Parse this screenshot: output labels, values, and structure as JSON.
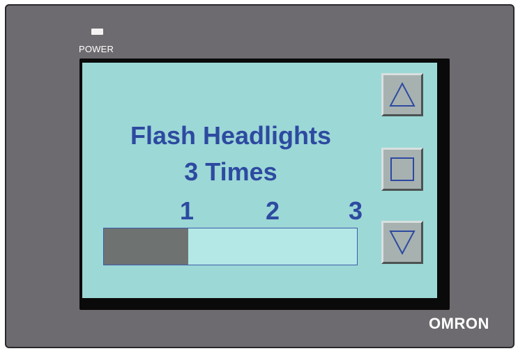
{
  "device": {
    "power_label": "POWER",
    "brand": "OMRON"
  },
  "screen": {
    "title_line1": "Flash Headlights",
    "title_line2": "3 Times",
    "scale_ticks": [
      "1",
      "2",
      "3"
    ],
    "progress_fraction": 0.333,
    "colors": {
      "background": "#9cd8d6",
      "text": "#2d4aa0",
      "progress_fill": "#6e7372"
    }
  },
  "controls": [
    {
      "name": "up-button",
      "icon": "triangle-up-icon"
    },
    {
      "name": "stop-button",
      "icon": "square-icon"
    },
    {
      "name": "down-button",
      "icon": "triangle-down-icon"
    }
  ]
}
